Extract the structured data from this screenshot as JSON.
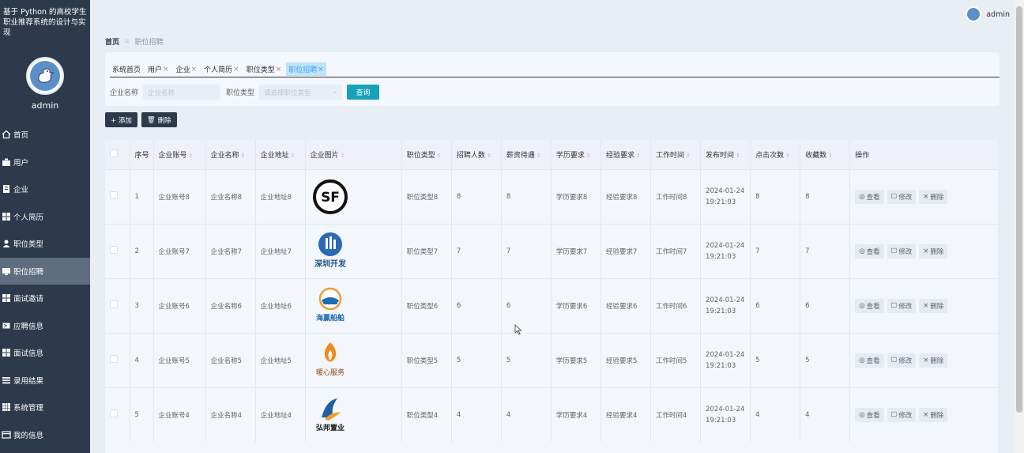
{
  "app": {
    "title": "基于 Python 的高校学生职业推荐系统的设计与实现",
    "username": "admin"
  },
  "sidebar": {
    "items": [
      {
        "label": "首页",
        "icon": "home-icon"
      },
      {
        "label": "用户",
        "icon": "user-group-icon"
      },
      {
        "label": "企业",
        "icon": "building-icon"
      },
      {
        "label": "个人简历",
        "icon": "grid-icon"
      },
      {
        "label": "职位类型",
        "icon": "person-icon"
      },
      {
        "label": "职位招聘",
        "icon": "monitor-icon",
        "active": true
      },
      {
        "label": "面试邀请",
        "icon": "grid-icon"
      },
      {
        "label": "应聘信息",
        "icon": "ticket-icon"
      },
      {
        "label": "面试信息",
        "icon": "grid-icon"
      },
      {
        "label": "录用结果",
        "icon": "list-icon"
      },
      {
        "label": "系统管理",
        "icon": "apps-icon"
      },
      {
        "label": "我的信息",
        "icon": "card-icon"
      }
    ]
  },
  "breadcrumb": {
    "home": "首页",
    "separator": "≡",
    "current": "职位招聘"
  },
  "tabs": [
    {
      "label": "系统首页",
      "closable": false
    },
    {
      "label": "用户",
      "closable": true
    },
    {
      "label": "企业",
      "closable": true
    },
    {
      "label": "个人简历",
      "closable": true
    },
    {
      "label": "职位类型",
      "closable": true
    },
    {
      "label": "职位招聘",
      "closable": true,
      "active": true
    }
  ],
  "search": {
    "company_label": "企业名称",
    "company_placeholder": "企业名称",
    "type_label": "职位类型",
    "type_placeholder": "请选择职位类型",
    "search_button": "查询"
  },
  "toolbar": {
    "add": "+ 添加",
    "delete": "删除"
  },
  "table": {
    "headers": [
      "序号",
      "企业账号",
      "企业名称",
      "企业地址",
      "企业图片",
      "职位类型",
      "招聘人数",
      "薪资待遇",
      "学历要求",
      "经验要求",
      "工作时间",
      "发布时间",
      "点击次数",
      "收藏数",
      "操作"
    ],
    "ops": {
      "view": "查看",
      "edit": "修改",
      "delete": "删除"
    },
    "rows": [
      {
        "no": "1",
        "account": "企业账号8",
        "name": "企业名称8",
        "addr": "企业地址8",
        "logo": "SF",
        "type": "职位类型8",
        "count": "8",
        "salary": "8",
        "edu": "学历要求8",
        "exp": "经验要求8",
        "work": "工作时间8",
        "date": "2024-01-24",
        "time": "19:21:03",
        "clicks": "8",
        "favs": "8"
      },
      {
        "no": "2",
        "account": "企业账号7",
        "name": "企业名称7",
        "addr": "企业地址7",
        "logo": "深圳开发",
        "type": "职位类型7",
        "count": "7",
        "salary": "7",
        "edu": "学历要求7",
        "exp": "经验要求7",
        "work": "工作时间7",
        "date": "2024-01-24",
        "time": "19:21:03",
        "clicks": "7",
        "favs": "7"
      },
      {
        "no": "3",
        "account": "企业账号6",
        "name": "企业名称6",
        "addr": "企业地址6",
        "logo": "海赢船舶",
        "type": "职位类型6",
        "count": "6",
        "salary": "6",
        "edu": "学历要求6",
        "exp": "经验要求6",
        "work": "工作时间6",
        "date": "2024-01-24",
        "time": "19:21:03",
        "clicks": "6",
        "favs": "6"
      },
      {
        "no": "4",
        "account": "企业账号5",
        "name": "企业名称5",
        "addr": "企业地址5",
        "logo": "暖心服务",
        "type": "职位类型5",
        "count": "5",
        "salary": "5",
        "edu": "学历要求5",
        "exp": "经验要求5",
        "work": "工作时间5",
        "date": "2024-01-24",
        "time": "19:21:03",
        "clicks": "5",
        "favs": "5"
      },
      {
        "no": "5",
        "account": "企业账号4",
        "name": "企业名称4",
        "addr": "企业地址4",
        "logo": "弘邦置业",
        "type": "职位类型4",
        "count": "4",
        "salary": "4",
        "edu": "学历要求4",
        "exp": "经验要求4",
        "work": "工作时间4",
        "date": "2024-01-24",
        "time": "19:21:03",
        "clicks": "4",
        "favs": "4"
      }
    ]
  },
  "colors": {
    "sidebar_bg": "#2d3a4b",
    "active_menu": "#5f6d80",
    "search_btn": "#17a2b8",
    "active_tab": "#bfe4f7"
  }
}
